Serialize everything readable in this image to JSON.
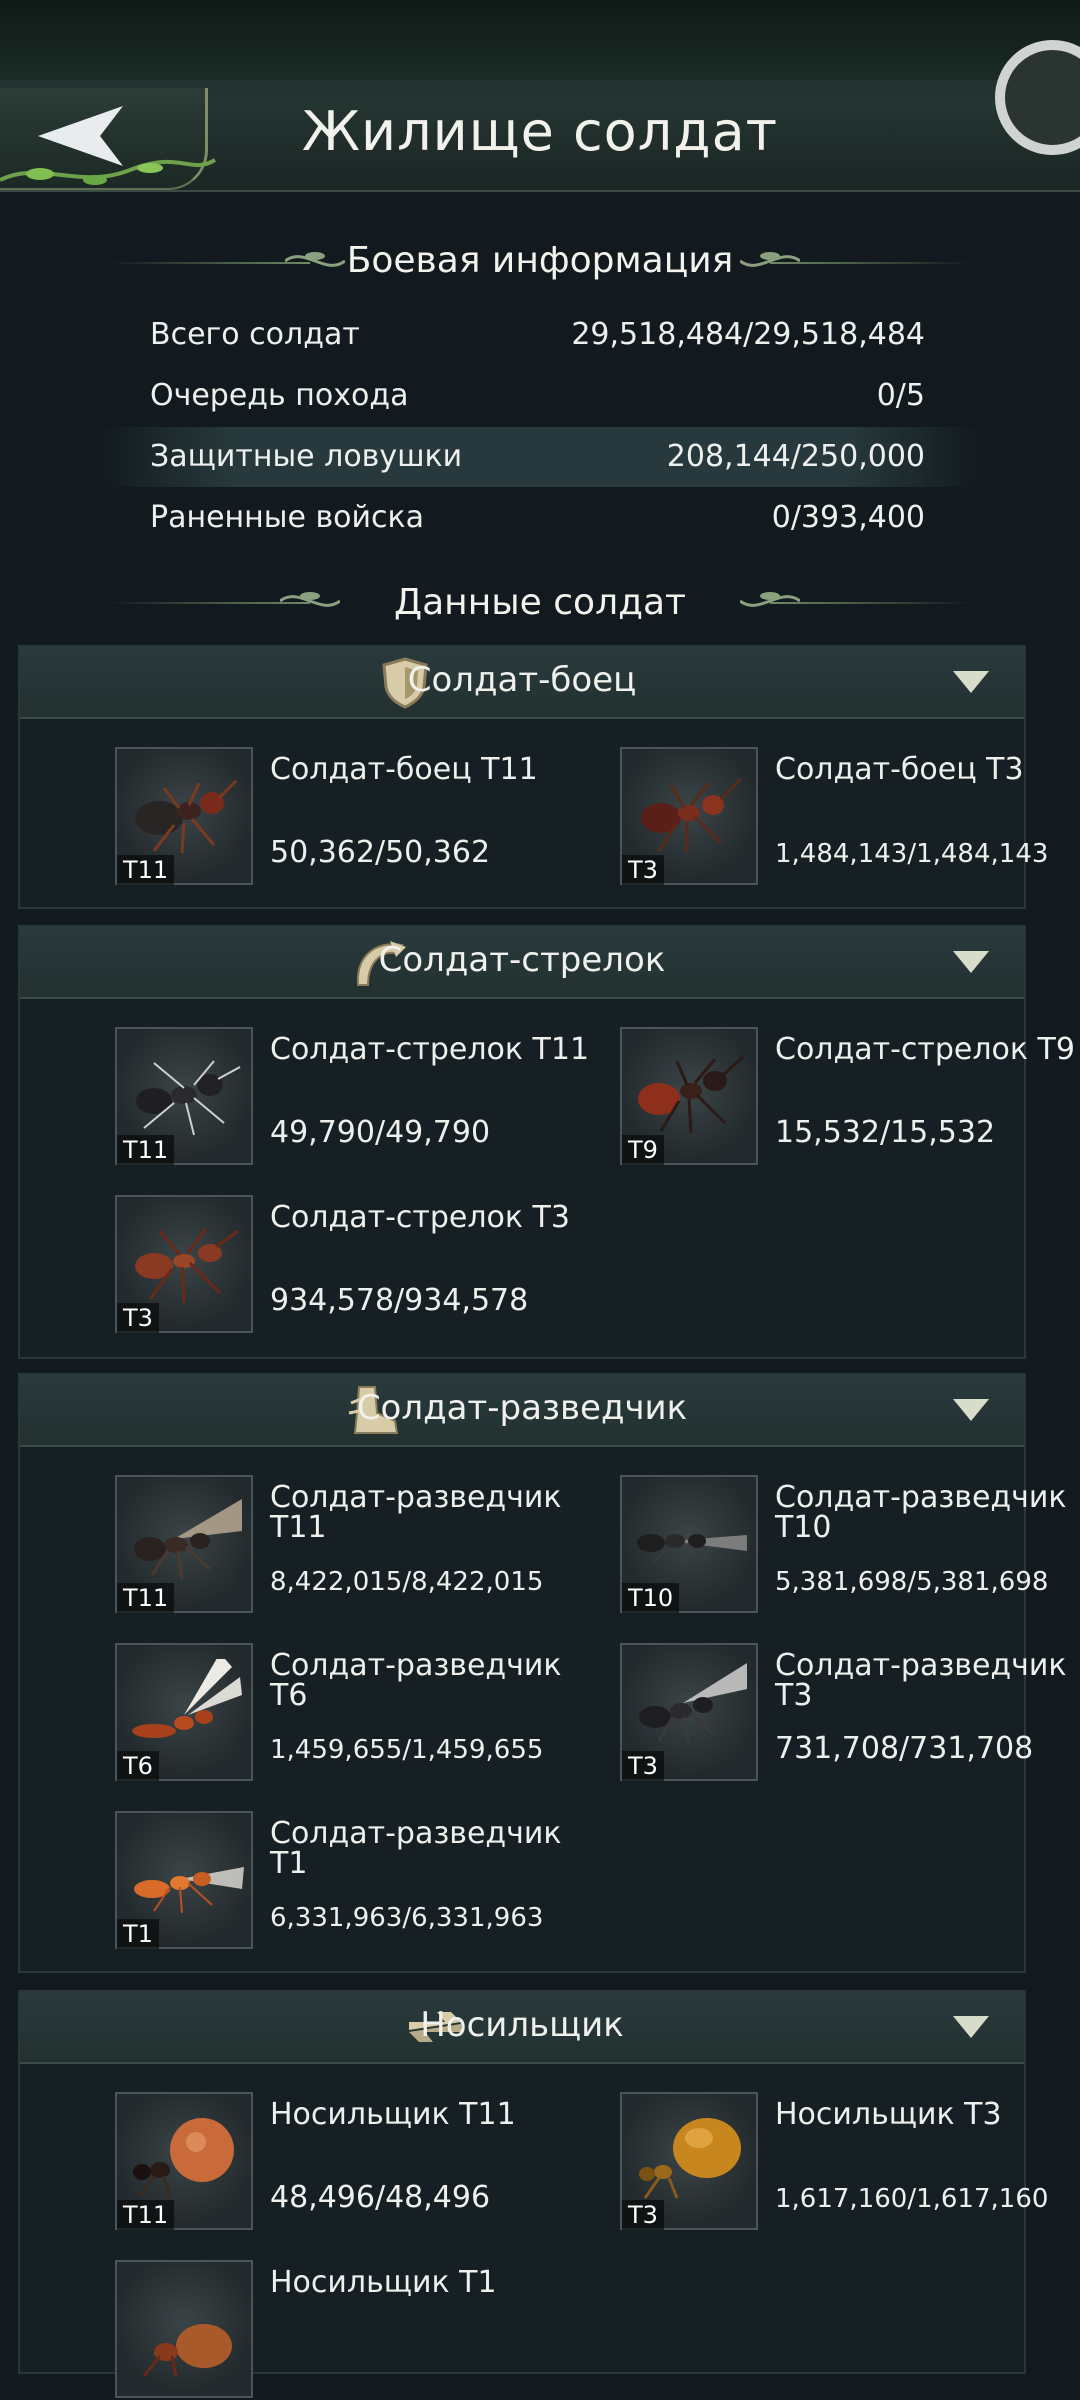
{
  "header": {
    "title": "Жилище солдат"
  },
  "battle_info": {
    "title": "Боевая информация",
    "rows": [
      {
        "label": "Всего солдат",
        "value": "29,518,484/29,518,484"
      },
      {
        "label": "Очередь похода",
        "value": "0/5"
      },
      {
        "label": "Защитные ловушки",
        "value": "208,144/250,000"
      },
      {
        "label": "Раненные войска",
        "value": "0/393,400"
      }
    ]
  },
  "soldier_data": {
    "title": "Данные солдат"
  },
  "categories": [
    {
      "title": "Солдат-боец",
      "units": [
        {
          "name": "Солдат-боец T11",
          "count": "50,362/50,362",
          "tier": "T11"
        },
        {
          "name": "Солдат-боец T3",
          "count": "1,484,143/1,484,143",
          "tier": "T3"
        }
      ]
    },
    {
      "title": "Солдат-стрелок",
      "units": [
        {
          "name": "Солдат-стрелок T11",
          "count": "49,790/49,790",
          "tier": "T11"
        },
        {
          "name": "Солдат-стрелок T9",
          "count": "15,532/15,532",
          "tier": "T9"
        },
        {
          "name": "Солдат-стрелок T3",
          "count": "934,578/934,578",
          "tier": "T3"
        }
      ]
    },
    {
      "title": "Солдат-разведчик",
      "units": [
        {
          "name": "Солдат-разведчик T11",
          "count": "8,422,015/8,422,015",
          "tier": "T11"
        },
        {
          "name": "Солдат-разведчик T10",
          "count": "5,381,698/5,381,698",
          "tier": "T10"
        },
        {
          "name": "Солдат-разведчик T6",
          "count": "1,459,655/1,459,655",
          "tier": "T6"
        },
        {
          "name": "Солдат-разведчик T3",
          "count": "731,708/731,708",
          "tier": "T3"
        },
        {
          "name": "Солдат-разведчик T1",
          "count": "6,331,963/6,331,963",
          "tier": "T1"
        }
      ]
    },
    {
      "title": "Носильщик",
      "units": [
        {
          "name": "Носильщик T11",
          "count": "48,496/48,496",
          "tier": "T11"
        },
        {
          "name": "Носильщик T3",
          "count": "1,617,160/1,617,160",
          "tier": "T3"
        },
        {
          "name": "Носильщик T1",
          "tier": ""
        }
      ]
    }
  ],
  "icons": {
    "back": "back-arrow-icon",
    "fighter": "shield-icon",
    "archer": "bow-icon",
    "scout": "boot-icon",
    "carrier": "transfer-arrows-icon",
    "expand": "triangle-down-icon"
  },
  "colors": {
    "background": "#121a1f",
    "accent": "#d8dccb",
    "panel": "#161f23"
  }
}
